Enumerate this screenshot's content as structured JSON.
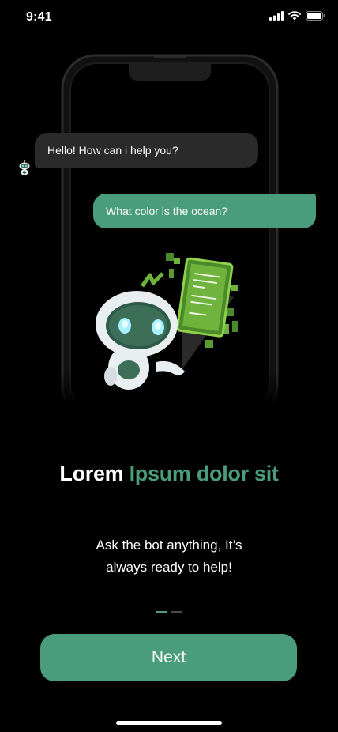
{
  "status_bar": {
    "time": "9:41",
    "icons": [
      "signal-icon",
      "wifi-icon",
      "battery-icon"
    ]
  },
  "chat": {
    "bot_message": "Hello! How can i help you?",
    "user_message": "What color is the ocean?"
  },
  "headline": {
    "part1": "Lorem",
    "part2": "Ipsum dolor sit"
  },
  "subtitle": {
    "line1": "Ask the bot anything, It’s",
    "line2": "always ready to help!"
  },
  "pager": {
    "total": 2,
    "current": 1
  },
  "next_label": "Next",
  "colors": {
    "accent": "#4a9d7c",
    "background": "#000000",
    "bot_bubble": "#2a2a2a",
    "text": "#ffffff"
  }
}
